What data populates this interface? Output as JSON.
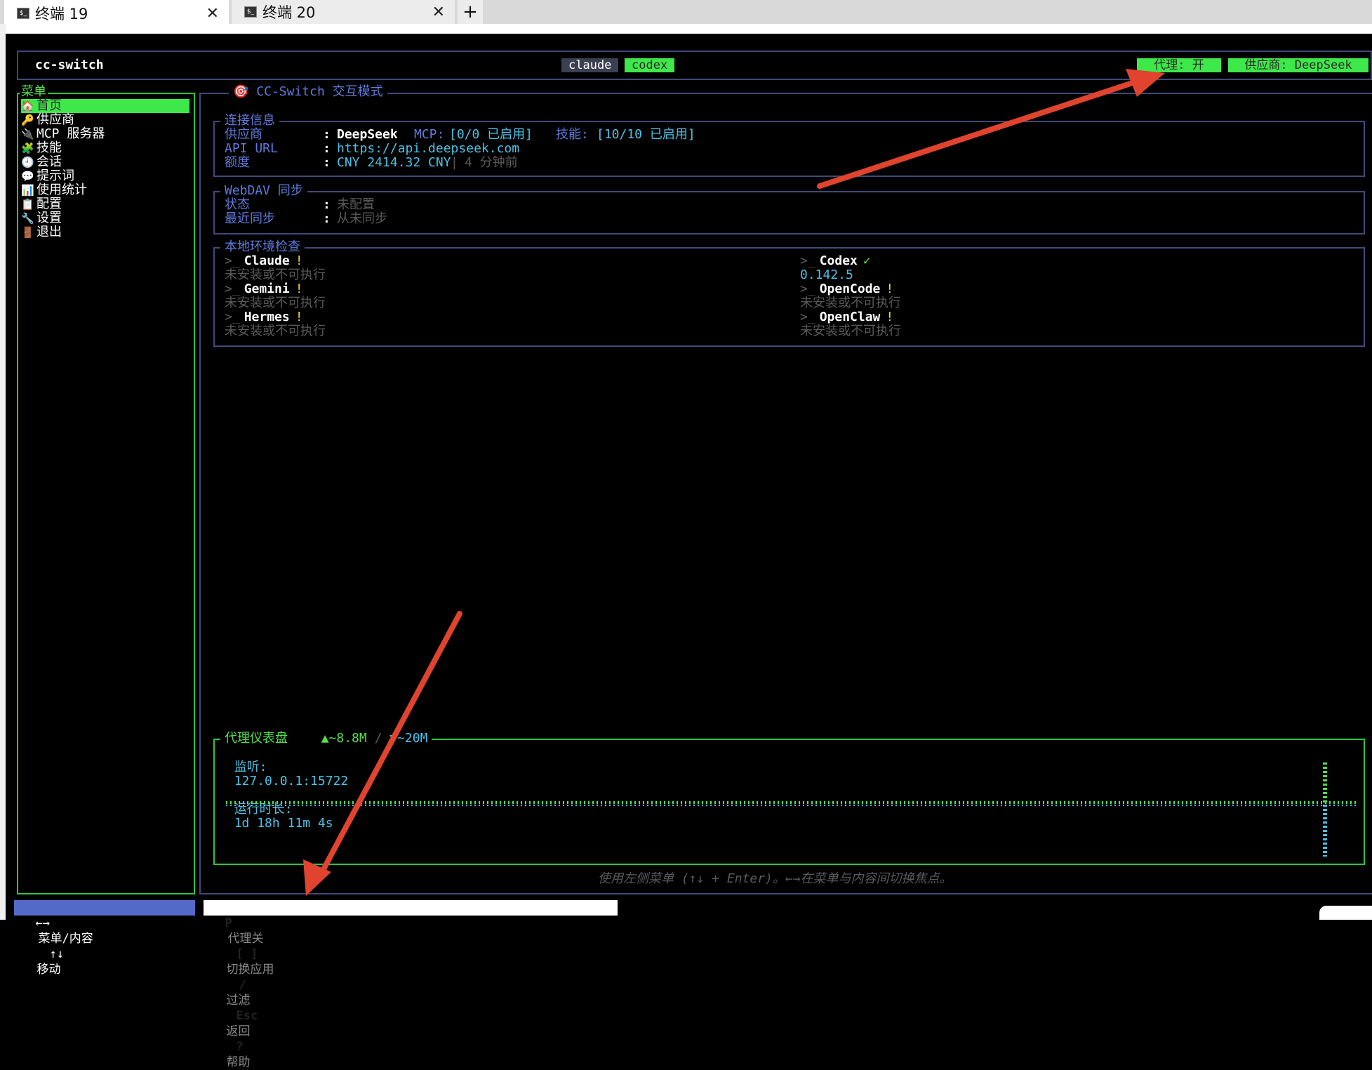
{
  "window": {
    "tabs": [
      {
        "label": "终端 19",
        "active": true
      },
      {
        "label": "终端 20",
        "active": false
      }
    ],
    "new_tab": "+",
    "close_glyph": "✕"
  },
  "header": {
    "app": "cc-switch",
    "app_tabs": [
      {
        "label": "claude",
        "active": false
      },
      {
        "label": "codex",
        "active": true
      }
    ],
    "proxy_status": "代理: 开",
    "provider_status": "供应商: DeepSeek"
  },
  "menu": {
    "title": "菜单",
    "items": [
      {
        "label": "首页",
        "icon": "home-icon",
        "glyph": "🏠",
        "selected": true
      },
      {
        "label": "供应商",
        "icon": "key-icon",
        "glyph": "🔑"
      },
      {
        "label": "MCP 服务器",
        "icon": "plug-icon",
        "glyph": "🔌"
      },
      {
        "label": "技能",
        "icon": "puzzle-icon",
        "glyph": "🧩"
      },
      {
        "label": "会话",
        "icon": "clock-icon",
        "glyph": "🕘"
      },
      {
        "label": "提示词",
        "icon": "speech-bubble-icon",
        "glyph": "💬"
      },
      {
        "label": "使用统计",
        "icon": "chart-icon",
        "glyph": "📊"
      },
      {
        "label": "配置",
        "icon": "clipboard-icon",
        "glyph": "📋"
      },
      {
        "label": "设置",
        "icon": "wrench-icon",
        "glyph": "🔧"
      },
      {
        "label": "退出",
        "icon": "door-icon",
        "glyph": "🚪"
      }
    ]
  },
  "main": {
    "title": "CC-Switch 交互模式",
    "title_icon": "target-icon",
    "connection": {
      "title": "连接信息",
      "provider_label": "供应商",
      "provider_value": "DeepSeek",
      "mcp_label": "MCP:",
      "mcp_value": "[0/0 已启用]",
      "skills_label": "技能:",
      "skills_value": "[10/10 已启用]",
      "api_label": "API URL",
      "api_value": "https://api.deepseek.com",
      "quota_label": "额度",
      "quota_value": "CNY 2414.32 CNY",
      "quota_sep": "|",
      "quota_time": "4 分钟前",
      "colon": ":"
    },
    "webdav": {
      "title": "WebDAV 同步",
      "status_label": "状态",
      "status_value": "未配置",
      "last_sync_label": "最近同步",
      "last_sync_value": "从未同步"
    },
    "env": {
      "title": "本地环境检查",
      "prompt": ">_",
      "tools": [
        {
          "name": "Claude",
          "mark": "!",
          "detail": "未安装或不可执行",
          "ok": false
        },
        {
          "name": "Codex",
          "mark": "✓",
          "detail": "0.142.5",
          "ok": true
        },
        {
          "name": "Gemini",
          "mark": "!",
          "detail": "未安装或不可执行",
          "ok": false
        },
        {
          "name": "OpenCode",
          "mark": "!",
          "detail": "未安装或不可执行",
          "ok": false
        },
        {
          "name": "Hermes",
          "mark": "!",
          "detail": "未安装或不可执行",
          "ok": false
        },
        {
          "name": "OpenClaw",
          "mark": "!",
          "detail": "未安装或不可执行",
          "ok": false
        }
      ]
    },
    "proxy_dashboard": {
      "title": "代理仪表盘",
      "up": "▲~8.8M",
      "sep": "/",
      "down": "▼~20M",
      "listen_label": "监听:",
      "listen_value": "127.0.0.1:15722",
      "uptime_label": "运行时长:",
      "uptime_value": "1d 18h 11m 4s"
    },
    "hint": "使用左侧菜单 (↑↓ + Enter)。←→在菜单与内容间切换焦点。"
  },
  "footer": {
    "left": [
      {
        "key": "←→",
        "label": "菜单/内容"
      },
      {
        "key": "↑↓",
        "label": "移动"
      }
    ],
    "right": [
      {
        "key": "P",
        "label": "代理关"
      },
      {
        "key": "[ ]",
        "label": "切换应用"
      },
      {
        "key": "/",
        "label": "过滤"
      },
      {
        "key": "Esc",
        "label": "返回"
      },
      {
        "key": "?",
        "label": "帮助"
      }
    ]
  },
  "colors": {
    "accent_green": "#3ee84a",
    "border_blue": "#3f4a78",
    "label_blue": "#5f7bdc",
    "annotation_red": "#e0432e"
  }
}
